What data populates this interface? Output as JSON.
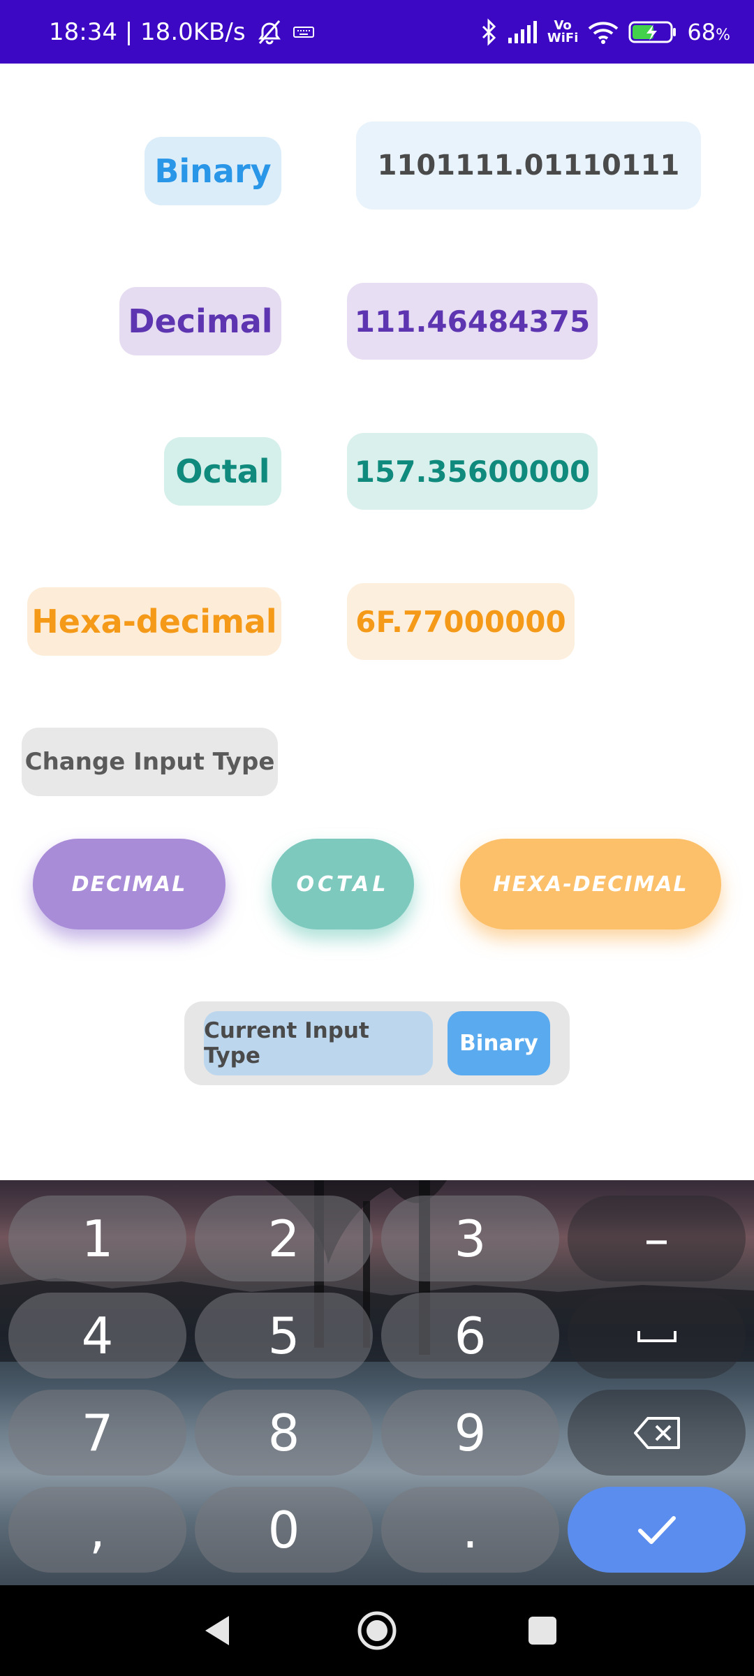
{
  "status_bar": {
    "time_speed": "18:34 | 18.0KB/s",
    "vowifi_top": "Vo",
    "vowifi_bottom": "WiFi",
    "battery": "68",
    "battery_unit": "%",
    "icons": [
      "alarm-off-icon",
      "keyboard-icon",
      "bluetooth-icon",
      "signal-icon",
      "wifi-icon",
      "battery-charging-icon"
    ]
  },
  "rows": {
    "binary": {
      "label": "Binary",
      "value": "1101111.01110111"
    },
    "decimal": {
      "label": "Decimal",
      "value": "111.46484375"
    },
    "octal": {
      "label": "Octal",
      "value": "157.35600000"
    },
    "hex": {
      "label": "Hexa-decimal",
      "value": "6F.77000000"
    }
  },
  "change_input_type": "Change Input Type",
  "type_buttons": {
    "decimal": "DECIMAL",
    "octal": "OCTAL",
    "hex": "HEXA-DECIMAL"
  },
  "current_input": {
    "label": "Current Input Type",
    "value": "Binary"
  },
  "keyboard": {
    "row1": [
      "1",
      "2",
      "3",
      "–"
    ],
    "row2": [
      "4",
      "5",
      "6"
    ],
    "row3": [
      "7",
      "8",
      "9"
    ],
    "row4": [
      ",",
      "0",
      "."
    ],
    "icons": [
      "space-icon",
      "backspace-icon",
      "checkmark-icon"
    ]
  },
  "nav_bar": {
    "icons": [
      "back-icon",
      "home-icon",
      "recents-icon"
    ]
  },
  "colors": {
    "status_bar": "#3d08c4",
    "binary": "#2a96e8",
    "decimal": "#5e35b1",
    "octal": "#0f8a7c",
    "hex": "#f59a18",
    "enter_key": "#5b8def"
  }
}
